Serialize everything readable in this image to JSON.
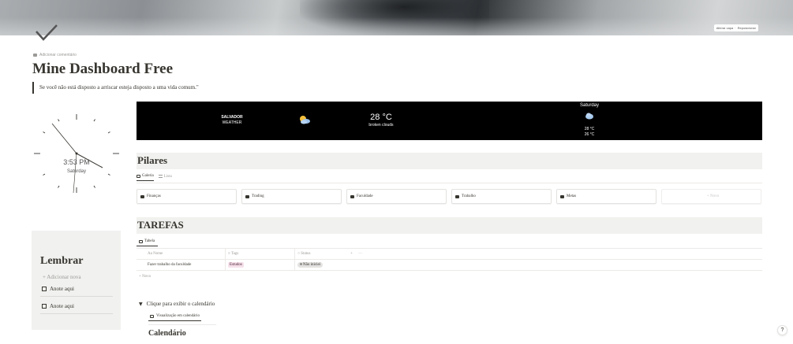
{
  "cover": {
    "change_cover_label": "Alterar capa",
    "separator": "·",
    "reposition_label": "Reposicionar"
  },
  "page": {
    "icon": "checkmark-icon",
    "add_comment_label": "Adicionar comentário",
    "title": "Mine Dashboard Free",
    "quote": "Se você não está disposto a arriscar esteja disposto a uma vida comum.\""
  },
  "clock": {
    "time": "3:53 PM",
    "day": "Saturday"
  },
  "weather": {
    "city": "SALVADOR",
    "city_sub": "WEATHER",
    "current_icon": "partly-cloudy-icon",
    "temperature": "28 °C",
    "description": "broken clouds",
    "forecast_day": "Saturday",
    "forecast_icon": "cloud-icon",
    "forecast_high": "28 °C",
    "forecast_low": "26 °C"
  },
  "pilares": {
    "title": "Pilares",
    "views": [
      {
        "label": "Galeria",
        "icon": "gallery-icon",
        "active": true
      },
      {
        "label": "Lista",
        "icon": "list-icon",
        "active": false
      }
    ],
    "cards": [
      "Finanças",
      "Trading",
      "Faculdade",
      "Trabalho",
      "Metas"
    ],
    "new_label": "+ Novo"
  },
  "tarefas": {
    "title": "TAREFAS",
    "view_label": "Tabela",
    "columns": {
      "name": "Aa Nome",
      "tags": "≡ Tags",
      "status": "○ Status",
      "add": "+",
      "more": "···"
    },
    "rows": [
      {
        "name": "Fazer trabalho da faculdade",
        "tag": "Estudos",
        "status": "Não iniciei"
      }
    ],
    "new_label": "+ Novo",
    "colors": {
      "tag_bg": "#f5e0e9",
      "status_bg": "#e3e2e0"
    }
  },
  "calendar": {
    "toggle_label": "Clique para exibir o calendário",
    "view_label": "Visualização em calendário",
    "title": "Calendário"
  },
  "remember": {
    "title": "Lembrar",
    "add_label": "+ Adicionar nova",
    "items": [
      "Anote aqui",
      "Anote aqui"
    ]
  },
  "help": {
    "label": "?"
  }
}
